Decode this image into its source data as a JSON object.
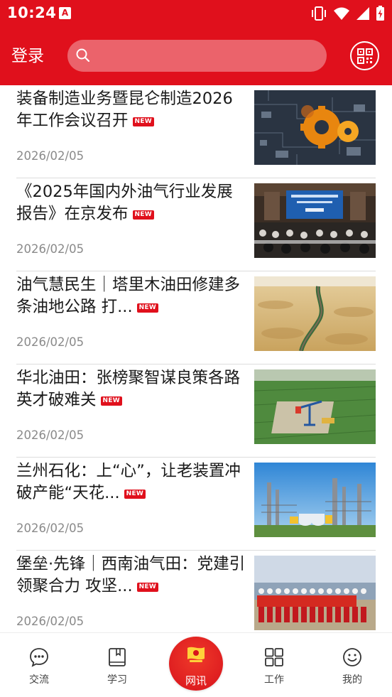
{
  "status_bar": {
    "time": "10:24",
    "icons": [
      "app-notification-icon",
      "vibrate-icon",
      "wifi-icon",
      "signal-icon",
      "battery-charging-icon"
    ]
  },
  "header": {
    "login_label": "登录",
    "search_placeholder": "",
    "icons": [
      "search-icon",
      "qr-code-icon"
    ]
  },
  "news": [
    {
      "title": "装备制造业务暨昆仑制造2026年工作会议召开",
      "badge": "NEW",
      "date": "2026/02/05",
      "thumb": "gears-circuit-board"
    },
    {
      "title": "《2025年国内外油气行业发展报告》在京发布",
      "badge": "NEW",
      "date": "2026/02/05",
      "thumb": "conference-hall"
    },
    {
      "title": "油气慧民生｜塔里木油田修建多条油地公路 打...",
      "badge": "NEW",
      "date": "2026/02/05",
      "thumb": "desert-road"
    },
    {
      "title": "华北油田：张榜聚智谋良策各路英才破难关",
      "badge": "NEW",
      "date": "2026/02/05",
      "thumb": "oil-pumpjack-field"
    },
    {
      "title": "兰州石化：上“心”，让老装置冲破产能“天花...",
      "badge": "NEW",
      "date": "2026/02/05",
      "thumb": "refinery-plant"
    },
    {
      "title": "堡垒·先锋｜西南油气田：党建引领聚合力 攻坚...",
      "badge": "NEW",
      "date": "2026/02/05",
      "thumb": "team-with-banner"
    }
  ],
  "bottom_nav": [
    {
      "label": "交流",
      "icon": "chat-bubble-icon"
    },
    {
      "label": "学习",
      "icon": "book-icon"
    },
    {
      "label": "网讯",
      "icon": "party-flag-logo-icon"
    },
    {
      "label": "工作",
      "icon": "grid-apps-icon"
    },
    {
      "label": "我的",
      "icon": "smiley-face-icon"
    }
  ],
  "colors": {
    "brand_red": "#e0101c",
    "date_gray": "#8a8a8a",
    "divider": "#dcdcdc"
  }
}
